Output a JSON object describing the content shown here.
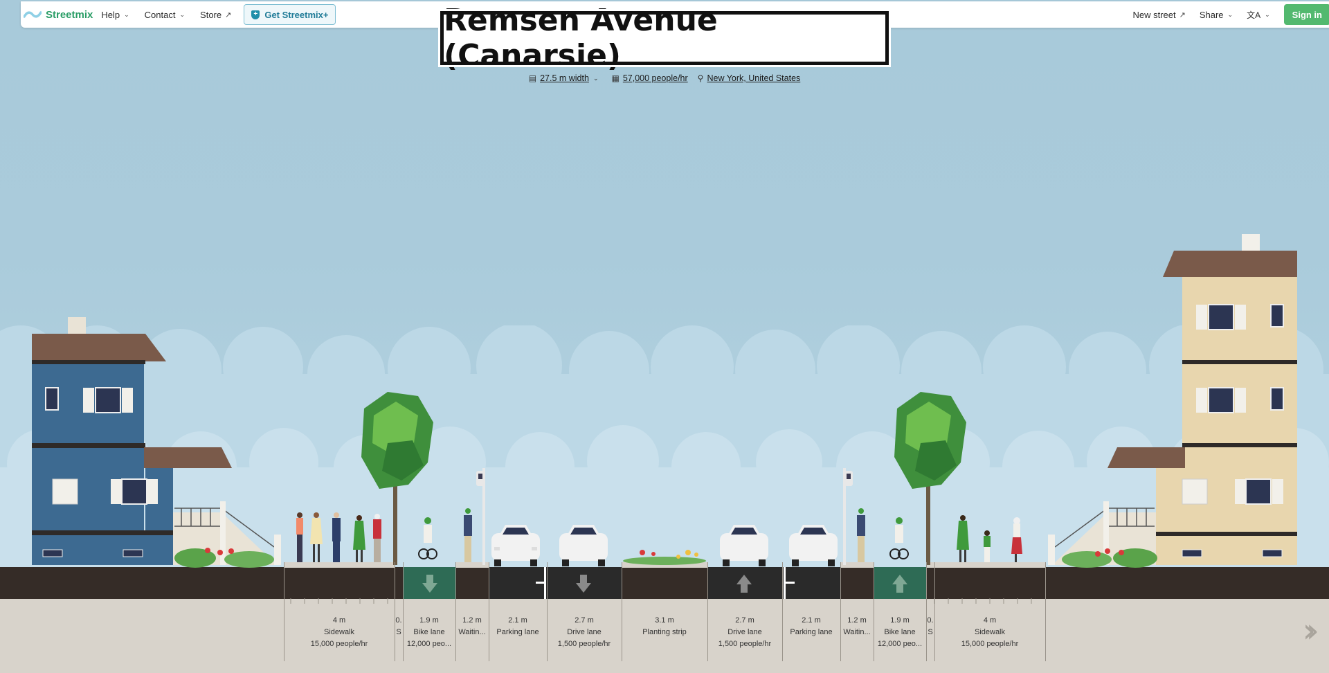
{
  "nav": {
    "brand": "Streetmix",
    "help": "Help",
    "contact": "Contact",
    "store": "Store",
    "get_plus": "Get Streetmix+",
    "new_street": "New street",
    "share": "Share",
    "language_icon": "translate-icon",
    "sign_in": "Sign in"
  },
  "street": {
    "title": "Remsen Avenue (Canarsie)",
    "width": "27.5 m width",
    "capacity": "57,000 people/hr",
    "location": "New York, United States"
  },
  "segments": [
    {
      "width": "4 m",
      "name": "Sidewalk",
      "capacity": "15,000 people/hr"
    },
    {
      "width": "0.",
      "name": "S",
      "capacity": ""
    },
    {
      "width": "1.9 m",
      "name": "Bike lane",
      "capacity": "12,000 peo..."
    },
    {
      "width": "1.2 m",
      "name": "Waitin...",
      "capacity": ""
    },
    {
      "width": "2.1 m",
      "name": "Parking lane",
      "capacity": ""
    },
    {
      "width": "2.7 m",
      "name": "Drive lane",
      "capacity": "1,500 people/hr"
    },
    {
      "width": "3.1 m",
      "name": "Planting strip",
      "capacity": ""
    },
    {
      "width": "2.7 m",
      "name": "Drive lane",
      "capacity": "1,500 people/hr"
    },
    {
      "width": "2.1 m",
      "name": "Parking lane",
      "capacity": ""
    },
    {
      "width": "1.2 m",
      "name": "Waitin...",
      "capacity": ""
    },
    {
      "width": "1.9 m",
      "name": "Bike lane",
      "capacity": "12,000 peo..."
    },
    {
      "width": "0.",
      "name": "S",
      "capacity": ""
    },
    {
      "width": "4 m",
      "name": "Sidewalk",
      "capacity": "15,000 people/hr"
    }
  ],
  "colors": {
    "brand": "#2a9d66",
    "sign_in": "#53b96f",
    "bike_lane": "#2e6b55",
    "drive_lane": "#2a2a2a",
    "sky": "#a9cbdb"
  }
}
